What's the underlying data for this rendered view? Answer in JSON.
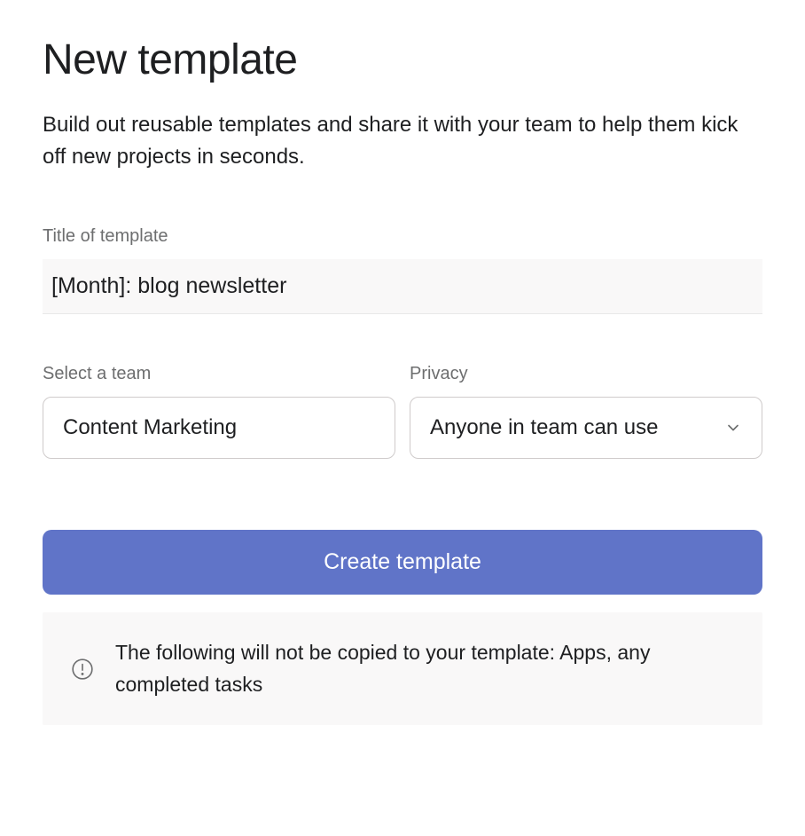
{
  "header": {
    "title": "New template",
    "subtitle": "Build out reusable templates and share it with your team to help them kick off new projects in seconds."
  },
  "form": {
    "title_label": "Title of template",
    "title_value": "[Month]: blog newsletter",
    "team": {
      "label": "Select a team",
      "value": "Content Marketing"
    },
    "privacy": {
      "label": "Privacy",
      "value": "Anyone in team can use"
    },
    "submit_label": "Create template"
  },
  "notice": {
    "text": "The following will not be copied to your template: Apps, any completed tasks"
  }
}
